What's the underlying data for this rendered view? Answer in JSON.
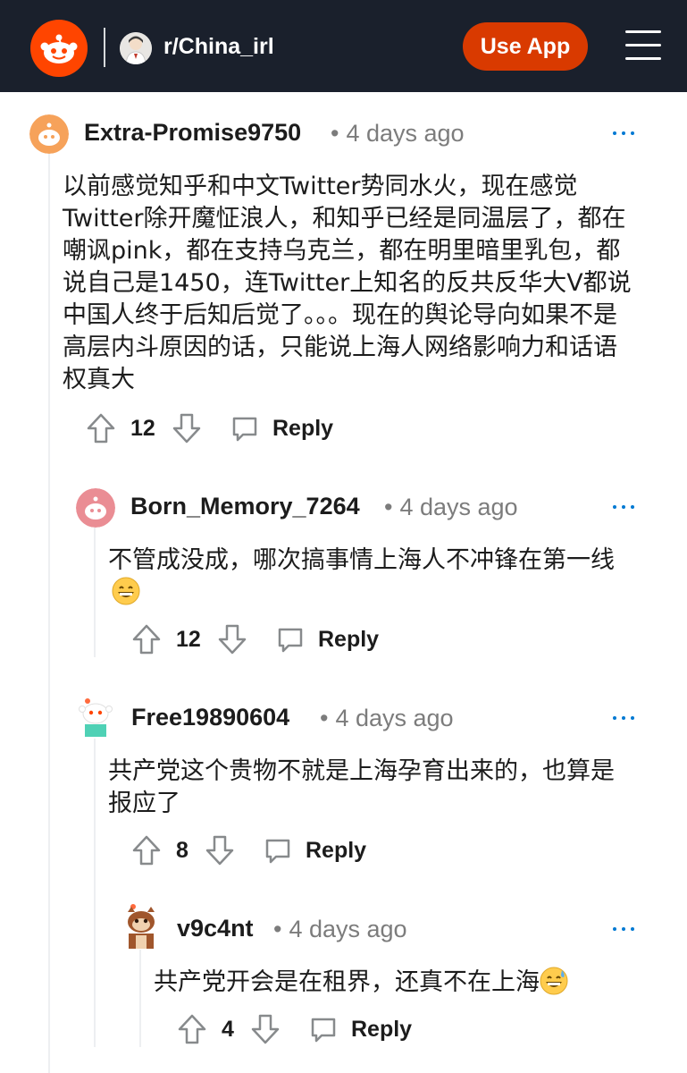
{
  "header": {
    "subreddit": "r/China_irl",
    "use_app_label": "Use App",
    "icons": {
      "logo": "reddit-logo",
      "menu": "hamburger-menu-icon"
    },
    "colors": {
      "bar": "#1a202c",
      "accent": "#d93a00",
      "logo": "#ff4500"
    }
  },
  "comments": [
    {
      "username": "Extra-Promise9750",
      "time": "4 days ago",
      "body": "以前感觉知乎和中文Twitter势同水火，现在感觉Twitter除开魔怔浪人，和知乎已经是同温层了，都在嘲讽pink，都在支持乌克兰，都在明里暗里乳包，都说自己是1450，连Twitter上知名的反共反华大V都说中国人终于后知后觉了。。。现在的舆论导向如果不是高层内斗原因的话，只能说上海人网络影响力和话语权真大",
      "votes": "12",
      "reply_label": "Reply",
      "avatar_color": "#f6a25a"
    },
    {
      "username": "Born_Memory_7264",
      "time": "4 days ago",
      "body": "不管成没成，哪次搞事情上海人不冲锋在第一线",
      "votes": "12",
      "reply_label": "Reply",
      "avatar_color": "#ea8d94"
    },
    {
      "username": "Free19890604",
      "time": "4 days ago",
      "body": "共产党这个贵物不就是上海孕育出来的，也算是报应了",
      "votes": "8",
      "reply_label": "Reply",
      "avatar_color": "#4fd1b5"
    },
    {
      "username": "v9c4nt",
      "time": "4 days ago",
      "body": "共产党开会是在租界，还真不在上海",
      "votes": "4",
      "reply_label": "Reply",
      "avatar_color": "#a0562c"
    }
  ],
  "emojis": {
    "grin": "grinning-face-emoji",
    "sweat": "grinning-sweat-emoji"
  }
}
